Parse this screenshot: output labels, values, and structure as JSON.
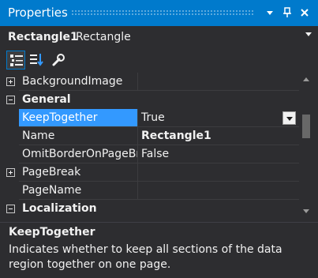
{
  "window": {
    "title": "Properties",
    "buttons": [
      "dropdown",
      "pin",
      "close"
    ]
  },
  "object_selector": {
    "name": "Rectangle1",
    "type": "Rectangle"
  },
  "toolbar": {
    "tools": [
      {
        "icon": "categorized-icon",
        "active": true
      },
      {
        "icon": "alphabetical-icon",
        "active": false
      },
      {
        "icon": "property-pages-icon",
        "active": false
      }
    ]
  },
  "grid": {
    "rows": [
      {
        "kind": "property",
        "expander": "plus",
        "name": "BackgroundImage",
        "value": ""
      },
      {
        "kind": "category",
        "expander": "minus",
        "name": "General"
      },
      {
        "kind": "property",
        "name": "KeepTogether",
        "value": "True",
        "selected": true,
        "has_dropdown": true
      },
      {
        "kind": "property",
        "name": "Name",
        "value": "Rectangle1",
        "value_bold": true
      },
      {
        "kind": "property",
        "name": "OmitBorderOnPageBreak",
        "value": "False"
      },
      {
        "kind": "property",
        "expander": "plus",
        "name": "PageBreak",
        "value": ""
      },
      {
        "kind": "property",
        "name": "PageName",
        "value": ""
      },
      {
        "kind": "category",
        "expander": "minus",
        "name": "Localization"
      }
    ]
  },
  "description": {
    "title": "KeepTogether",
    "text": "Indicates whether to keep all sections of the data region together on one page."
  },
  "colors": {
    "title_bar": "#007acc",
    "background": "#2d2d30",
    "selection": "#3399ff",
    "text": "#f1f1f1"
  }
}
